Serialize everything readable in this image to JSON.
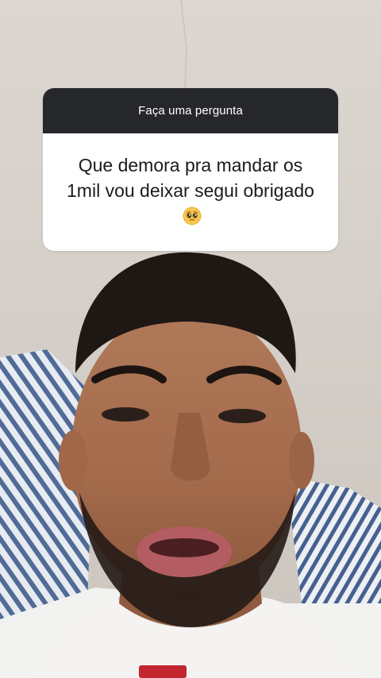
{
  "question_sticker": {
    "header": "Faça uma pergunta",
    "question": "Que demora pra mandar os 1mil vou deixar segui obrigado",
    "emoji_icon": "pleading-face-icon"
  },
  "colors": {
    "sticker_header_bg": "#26272b",
    "sticker_body_bg": "#ffffff"
  }
}
